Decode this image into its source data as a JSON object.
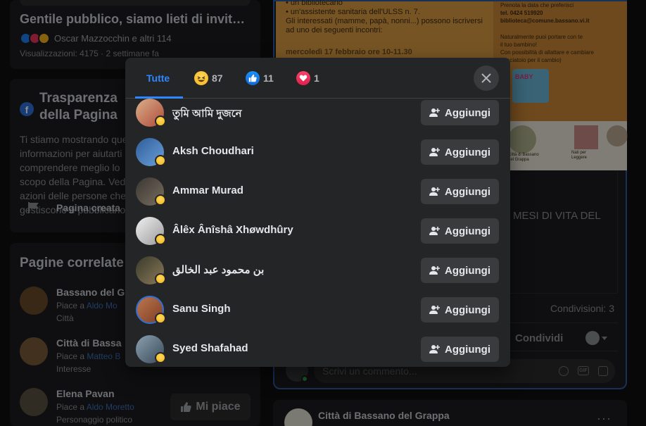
{
  "background": {
    "post_title": "Gentile pubblico, siamo lieti di invitarvi ...",
    "reactions_summary": "Oscar Mazzocchin e altri 114",
    "views": "Visualizzazioni: 4175 · 2 settimane fa",
    "transparency_title": "Trasparenza della Pagina",
    "transparency_text": "Ti stiamo mostrando queste informazioni per aiutarti a comprendere meglio lo scopo della Pagina. Vedi le azioni delle persone che gestiscono e pubblicano",
    "page_created": "Pagina creata",
    "related_title": "Pagine correlate",
    "related": [
      {
        "name": "Bassano del G",
        "like_prefix": "Piace a ",
        "like_link": "Aldo Mo",
        "category": "Città"
      },
      {
        "name": "Città di Bassa",
        "like_prefix": "Piace a ",
        "like_link": "Matteo B",
        "category": "Interesse"
      },
      {
        "name": "Elena Pavan",
        "like_prefix": "Piace a ",
        "like_link": "Aldo Moretto",
        "category": "Personaggio politico"
      }
    ],
    "like_button": "Mi piace",
    "poster_lines": [
      "• un bibliotecario",
      "• un'assistente sanitaria dell'ULSS n. 7.",
      "Gli interessati (mamme, papà, nonni...) possono iscriversi",
      "ad uno dei seguenti incontri:",
      "mercoledì 17 febbraio      ore 10-11.30"
    ],
    "poster_right_lines": [
      "Prenota la data che preferisci",
      "tel. 0424 519920",
      "biblioteca@comune.bassano.vi.it",
      "Naturalmente puoi portare con te",
      "il tuo bambino!",
      "Con possibilità di allattare e cambiare",
      "(fasciatoio per il cambio)"
    ],
    "baby_logo": "BABY",
    "seal_captions": [
      "Città di Bassano del Grappa",
      "Nati per Leggere"
    ],
    "mesi_text": "MESI DI VITA DEL",
    "paren_text": ")",
    "shares": "Condivisioni: 3",
    "share_label": "Condividi",
    "comment_placeholder": "Scrivi un commento...",
    "next_post_name": "Città di Bassano del Grappa"
  },
  "modal": {
    "tabs": [
      {
        "label": "Tutte",
        "icon": "none",
        "count": ""
      },
      {
        "label": "",
        "icon": "haha-icon",
        "count": "87"
      },
      {
        "label": "",
        "icon": "like-icon",
        "count": "11"
      },
      {
        "label": "",
        "icon": "love-icon",
        "count": "1"
      }
    ],
    "add_label": "Aggiungi",
    "people": [
      {
        "name": "তুমি আমি দুজনে",
        "avatar_color": "#c89a7a"
      },
      {
        "name": "Aksh Choudhari",
        "avatar_color": "#3a6fb0"
      },
      {
        "name": "Ammar Murad",
        "avatar_color": "#5a5550"
      },
      {
        "name": "Âlêx Ânîshâ Xhøwdhûry",
        "avatar_color": "#e0e0e0"
      },
      {
        "name": "بن محمود عبد الخالق",
        "avatar_color": "#4a4a40"
      },
      {
        "name": "Sanu Singh",
        "avatar_color": "#b06a48"
      },
      {
        "name": "Syed Shafahad",
        "avatar_color": "#6a7a8a"
      }
    ]
  },
  "colors": {
    "accent": "#2d88ff",
    "modal_bg": "#242526",
    "button_bg": "#3a3b3c"
  }
}
